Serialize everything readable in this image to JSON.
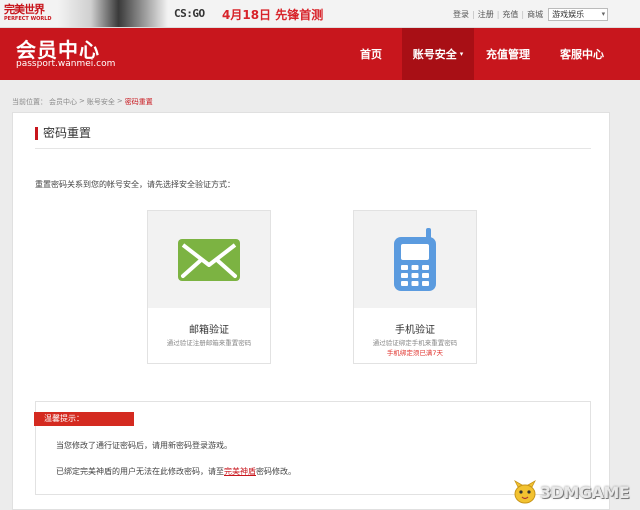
{
  "banner": {
    "brand_cn": "完美世界",
    "brand_en": "PERFECT WORLD",
    "game_logo": "CS:GO",
    "promo": "4月18日  先锋首测",
    "links": [
      "登录",
      "注册",
      "充值",
      "商城"
    ],
    "game_select": "游戏娱乐"
  },
  "header": {
    "title": "会员中心",
    "url": "passport.wanmei.com",
    "nav": [
      "首页",
      "账号安全",
      "充值管理",
      "客服中心"
    ],
    "nav_active": 1
  },
  "breadcrumb": {
    "prefix": "当前位置：",
    "items": [
      "会员中心",
      "账号安全",
      "密码重置"
    ],
    "separator": ">"
  },
  "panel": {
    "title": "密码重置",
    "intro": "重置密码关系到您的帐号安全，请先选择安全验证方式："
  },
  "options": [
    {
      "name": "邮箱验证",
      "desc": "通过验证注册邮箱来重置密码",
      "icon": "envelope-icon",
      "color": "#7cb342"
    },
    {
      "name": "手机验证",
      "desc": "通过验证绑定手机来重置密码",
      "warn": "手机绑定须已满7天",
      "icon": "mobile-phone-icon",
      "color": "#5b9bdf"
    }
  ],
  "tips": {
    "label": "温馨提示：",
    "line1": "当您修改了通行证密码后，请用新密码登录游戏。",
    "line2_before": "已绑定完美神盾的用户无法在此修改密码，请至",
    "line2_link": "完美神盾",
    "line2_after": "密码修改。"
  },
  "watermark": "3DMGAME",
  "colors": {
    "brand_red": "#c8161d",
    "nav_active": "#a80f15",
    "tips_red": "#d42a20"
  }
}
